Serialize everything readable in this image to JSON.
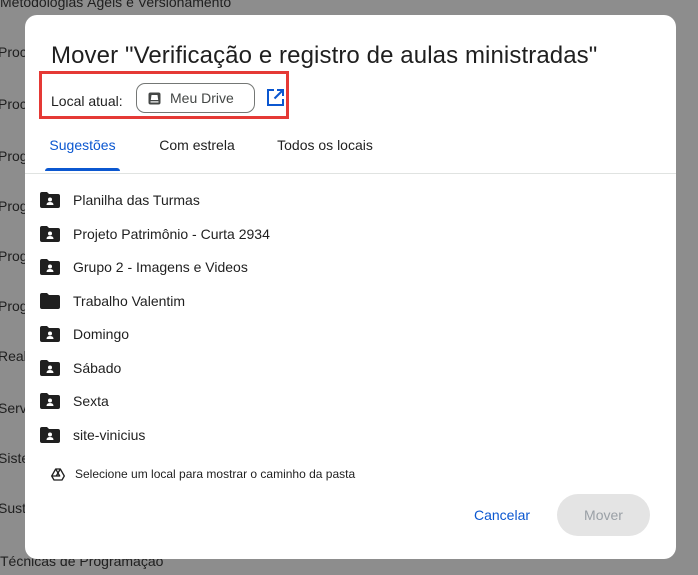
{
  "background": {
    "items": [
      "Metodologias Ágeis e Versionamento",
      "Proc",
      "Proc",
      "Prog",
      "Prog",
      "Prog",
      "Prog",
      "Real",
      "Serv",
      "Siste",
      "Sust",
      "Técnicas de Programação"
    ]
  },
  "dialog": {
    "title": "Mover \"Verificação e registro de aulas ministradas\"",
    "current_location_label": "Local atual:",
    "current_location_value": "Meu Drive",
    "tabs": [
      "Sugestões",
      "Com estrela",
      "Todos os locais"
    ],
    "active_tab": "Sugestões",
    "folders": [
      {
        "name": "Planilha das Turmas",
        "shared": true
      },
      {
        "name": "Projeto Patrimônio - Curta 2934",
        "shared": true
      },
      {
        "name": "Grupo 2 - Imagens e Videos",
        "shared": true
      },
      {
        "name": "Trabalho Valentim",
        "shared": false
      },
      {
        "name": "Domingo",
        "shared": true
      },
      {
        "name": "Sábado",
        "shared": true
      },
      {
        "name": "Sexta",
        "shared": true
      },
      {
        "name": "site-vinicius",
        "shared": true
      }
    ],
    "hint": "Selecione um local para mostrar o caminho da pasta",
    "cancel_label": "Cancelar",
    "move_label": "Mover"
  },
  "colors": {
    "accent": "#0b57d0",
    "highlight_box": "#e53935",
    "overlay": "#8d8d8d"
  }
}
